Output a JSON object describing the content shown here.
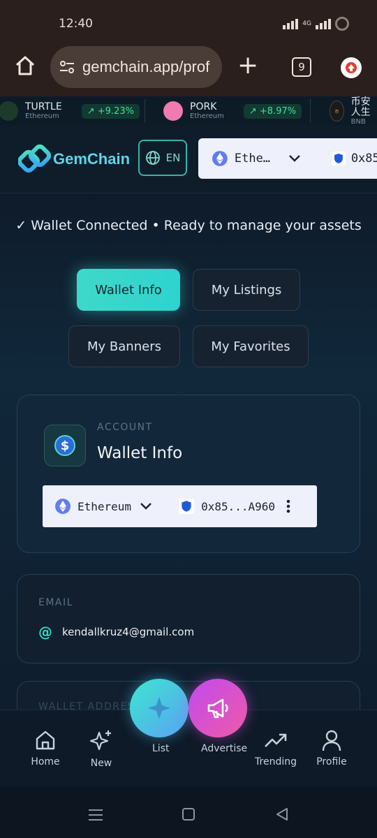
{
  "status_bar": {
    "time": "12:40",
    "network": "4G"
  },
  "browser": {
    "url": "gemchain.app/prof",
    "tab_count": "9"
  },
  "ticker": [
    {
      "name": "TURTLE",
      "chain": "Ethereum",
      "change": "+9.23%"
    },
    {
      "name": "PORK",
      "chain": "Ethereum",
      "change": "+8.97%"
    },
    {
      "name": "币安人生",
      "chain": "BNB"
    }
  ],
  "header": {
    "logo_text": "GemChain",
    "lang": "EN",
    "chain": "Ethe…",
    "address": "0x85…"
  },
  "main": {
    "connected_msg": "✓ Wallet Connected • Ready to manage your assets",
    "tabs": [
      "Wallet Info",
      "My Listings",
      "My Banners",
      "My Favorites"
    ],
    "account_label": "ACCOUNT",
    "account_title": "Wallet Info",
    "wallet": {
      "chain": "Ethereum",
      "address": "0x85...A960"
    },
    "email_label": "EMAIL",
    "email": "kendallkruz4@gmail.com",
    "wallet_address_label": "WALLET ADDRESS"
  },
  "nav": {
    "home": "Home",
    "new": "New",
    "list": "List",
    "advertise": "Advertise",
    "trending": "Trending",
    "profile": "Profile"
  },
  "colors": {
    "accent": "#2ed3cf",
    "advertise": "#d04ee0",
    "bg": "#0f1a28"
  }
}
